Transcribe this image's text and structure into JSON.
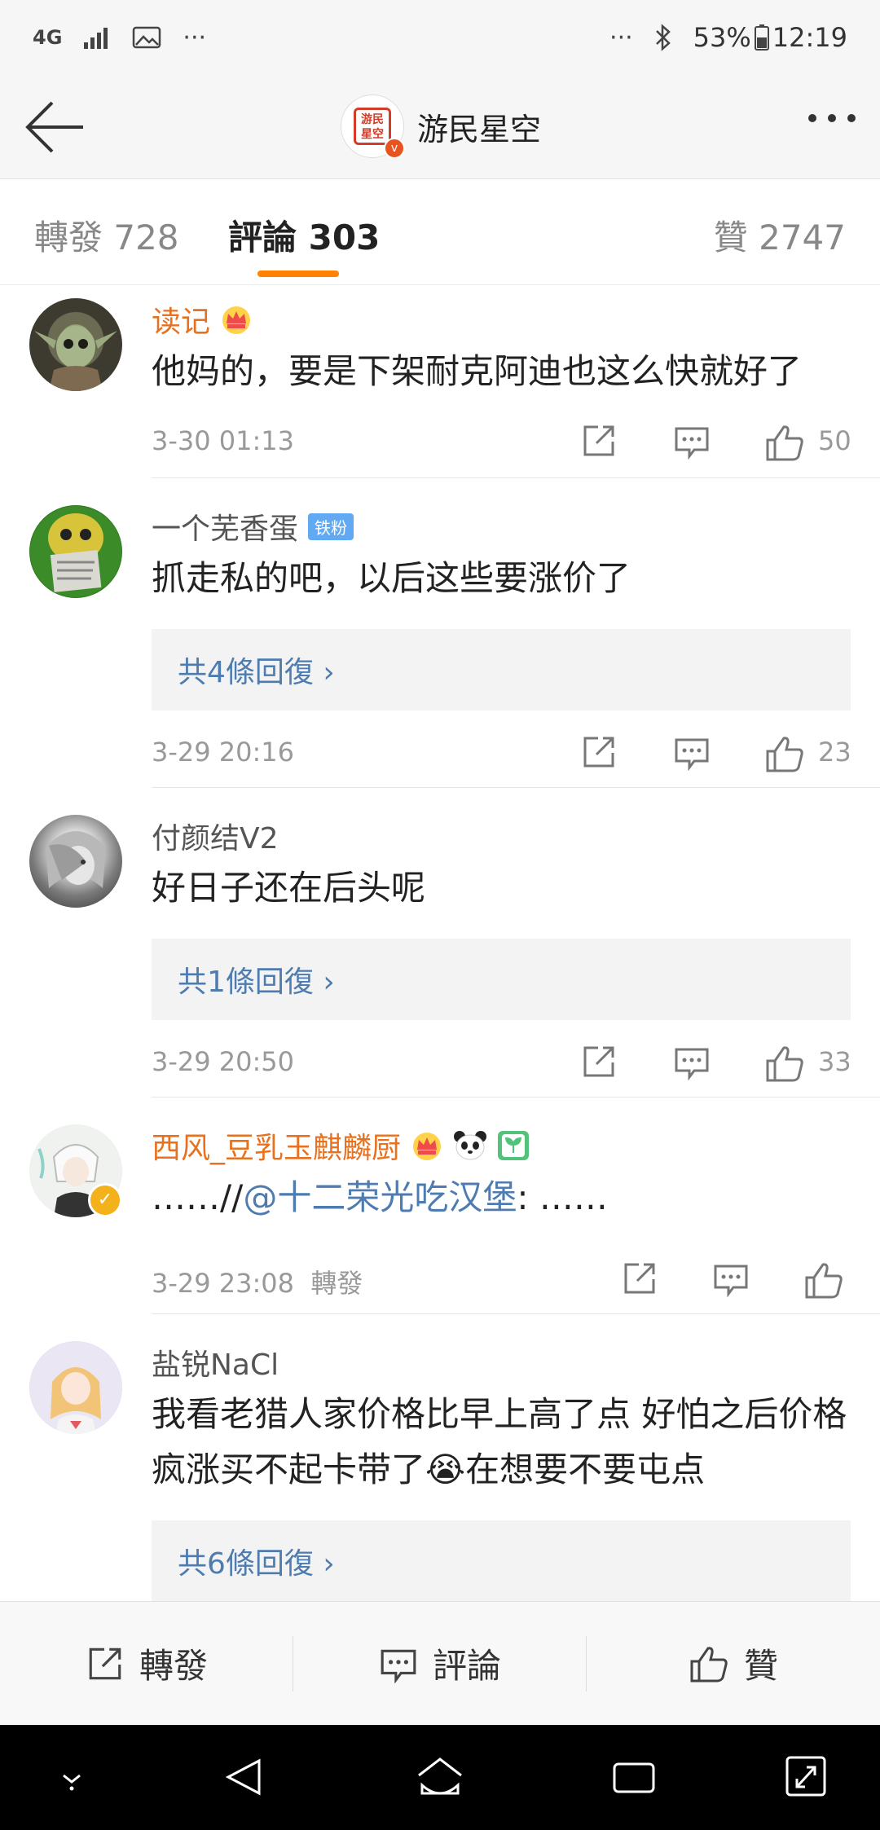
{
  "status_bar": {
    "left_icons": [
      "4G",
      "signal-icon",
      "image-icon",
      "···"
    ],
    "more": "···",
    "battery": "53%",
    "time": "12:19"
  },
  "header": {
    "title": "游民星空",
    "avatar_text": "游民\n星空",
    "badge": "v"
  },
  "tabs": [
    {
      "label": "轉發 728"
    },
    {
      "label": "評論 303"
    },
    {
      "label": "贊 2747"
    }
  ],
  "comments": [
    {
      "name": "读记",
      "text": "他妈的，要是下架耐克阿迪也这么快就好了",
      "time": "3-30 01:13",
      "likes": "50"
    },
    {
      "name": "一个芜香蛋",
      "badge": "铁粉",
      "text": "抓走私的吧，以后这些要涨价了",
      "replies": "共4條回復 ›",
      "time": "3-29 20:16",
      "likes": "23"
    },
    {
      "name": "付颜结V2",
      "text": "好日子还在后头呢",
      "replies": "共1條回復 ›",
      "time": "3-29 20:50",
      "likes": "33"
    },
    {
      "name": "西风_豆乳玉麒麟厨",
      "text_prefix": "……//",
      "mention": "@十二荣光吃汉堡",
      "text_suffix": ": ……",
      "time": "3-29 23:08",
      "repost_label": "轉發"
    },
    {
      "name": "盐锐NaCl",
      "text": "我看老猎人家价格比早上高了点 好怕之后价格疯涨买不起卡带了😭在想要不要屯点",
      "replies": "共6條回復 ›"
    }
  ],
  "bottom_bar": {
    "repost": "轉發",
    "comment": "評論",
    "like": "贊"
  },
  "colors": {
    "accent": "#ff8200",
    "link": "#4e7cb0",
    "vip_name": "#e8711f"
  }
}
